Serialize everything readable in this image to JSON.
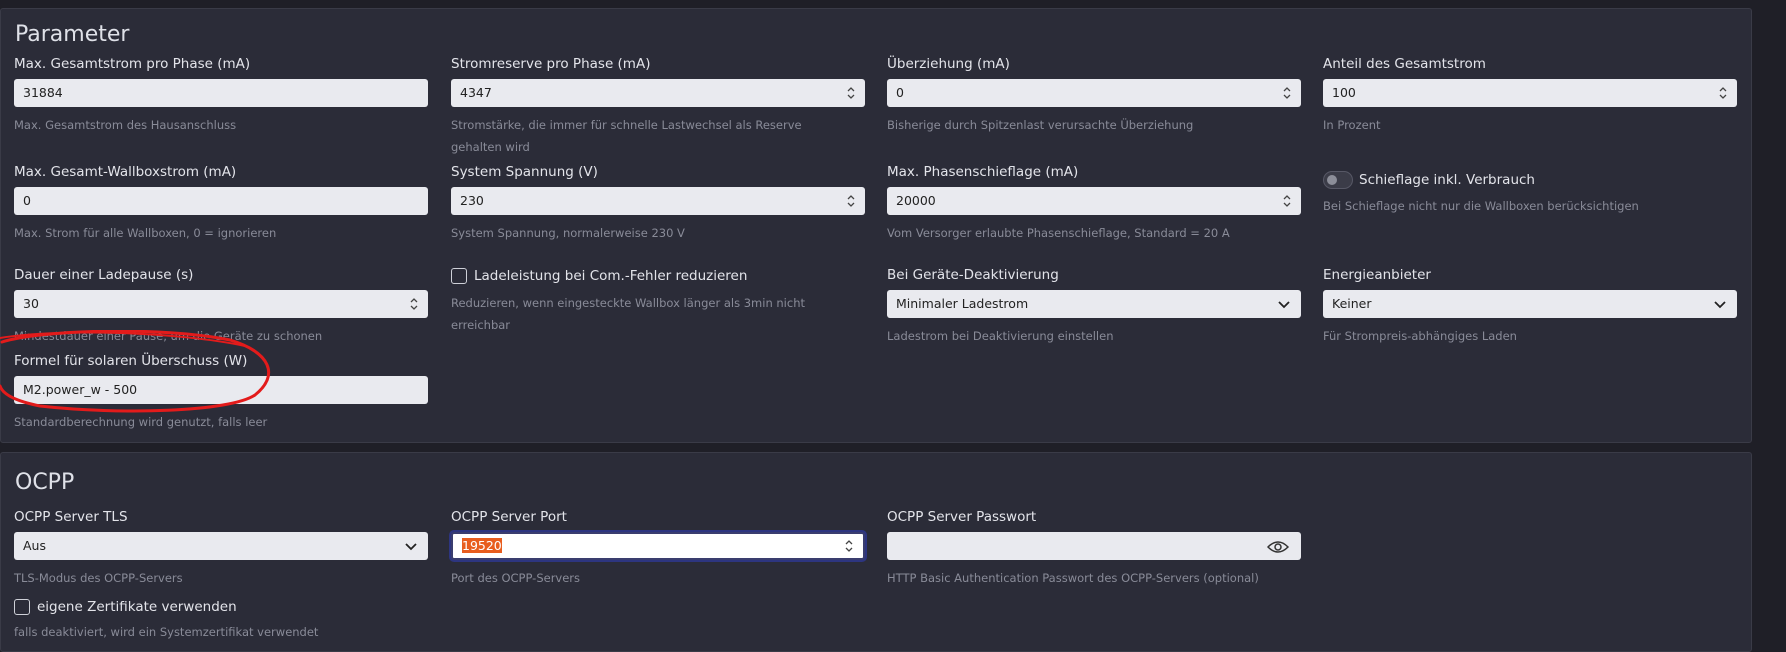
{
  "params": {
    "title": "Parameter",
    "max_total_current": {
      "label": "Max. Gesamtstrom pro Phase (mA)",
      "value": "31884",
      "help": "Max. Gesamtstrom des Hausanschluss"
    },
    "current_reserve": {
      "label": "Stromreserve pro Phase (mA)",
      "value": "4347",
      "help": "Stromstärke, die immer für schnelle Lastwechsel als Reserve gehalten wird"
    },
    "overdraw": {
      "label": "Überziehung (mA)",
      "value": "0",
      "help": "Bisherige durch Spitzenlast verursachte Überziehung"
    },
    "total_share": {
      "label": "Anteil des Gesamtstrom",
      "value": "100",
      "help": "In Prozent"
    },
    "max_wallbox_current": {
      "label": "Max. Gesamt-Wallboxstrom (mA)",
      "value": "0",
      "help": "Max. Strom für alle Wallboxen, 0 = ignorieren"
    },
    "system_voltage": {
      "label": "System Spannung (V)",
      "value": "230",
      "help": "System Spannung, normalerweise 230 V"
    },
    "max_phase_imbalance": {
      "label": "Max. Phasenschieflage (mA)",
      "value": "20000",
      "help": "Vom Versorger erlaubte Phasenschieflage, Standard = 20 A"
    },
    "imbalance_incl_consumption": {
      "label": "Schieflage inkl. Verbrauch",
      "help": "Bei Schieflage nicht nur die Wallboxen berücksichtigen"
    },
    "charge_pause": {
      "label": "Dauer einer Ladepause (s)",
      "value": "30",
      "help": "Mindestdauer einer Pause, um die Geräte zu schonen"
    },
    "reduce_on_error": {
      "label": "Ladeleistung bei Com.-Fehler reduzieren",
      "help": "Reduzieren, wenn eingesteckte Wallbox länger als 3min nicht erreichbar"
    },
    "device_deactivation": {
      "label": "Bei Geräte-Deaktivierung",
      "value": "Minimaler Ladestrom",
      "help": "Ladestrom bei Deaktivierung einstellen"
    },
    "energy_provider": {
      "label": "Energieanbieter",
      "value": "Keiner",
      "help": "Für Strompreis-abhängiges Laden"
    },
    "solar_formula": {
      "label": "Formel für solaren Überschuss (W)",
      "value": "M2.power_w - 500",
      "help": "Standardberechnung wird genutzt, falls leer"
    }
  },
  "ocpp": {
    "title": "OCPP",
    "tls": {
      "label": "OCPP Server TLS",
      "value": "Aus",
      "help": "TLS-Modus des OCPP-Servers"
    },
    "port": {
      "label": "OCPP Server Port",
      "value": "19520",
      "help": "Port des OCPP-Servers"
    },
    "password": {
      "label": "OCPP Server Passwort",
      "value": "",
      "help": "HTTP Basic Authentication Passwort des OCPP-Servers (optional)"
    },
    "own_certs": {
      "label": "eigene Zertifikate verwenden",
      "help": "falls deaktiviert, wird ein Systemzertifikat verwendet"
    }
  },
  "colors": {
    "annotation": "#e31b1b",
    "selection": "#e85d1e"
  },
  "icons": {
    "spin": "spinner-arrows-icon",
    "select": "chevron-down-icon",
    "password": "eye-icon"
  }
}
